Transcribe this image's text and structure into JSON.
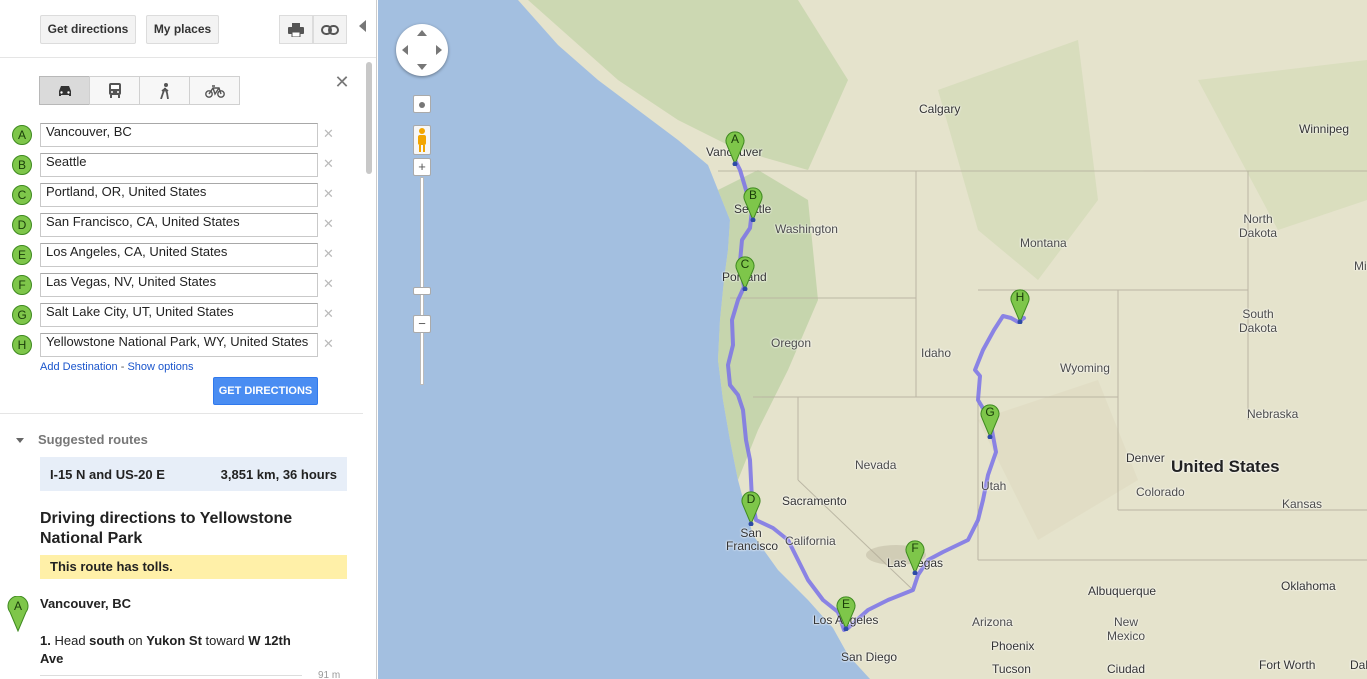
{
  "toolbar": {
    "get_directions": "Get directions",
    "my_places": "My places"
  },
  "waypoints": [
    {
      "letter": "A",
      "value": "Vancouver, BC"
    },
    {
      "letter": "B",
      "value": "Seattle"
    },
    {
      "letter": "C",
      "value": "Portland, OR, United States"
    },
    {
      "letter": "D",
      "value": "San Francisco, CA, United States"
    },
    {
      "letter": "E",
      "value": "Los Angeles, CA, United States"
    },
    {
      "letter": "F",
      "value": "Las Vegas, NV, United States"
    },
    {
      "letter": "G",
      "value": "Salt Lake City, UT, United States"
    },
    {
      "letter": "H",
      "value": "Yellowstone National Park, WY, United States"
    }
  ],
  "links": {
    "add_destination": "Add Destination",
    "separator": "-",
    "show_options": "Show options"
  },
  "get_directions_button": "GET DIRECTIONS",
  "suggested": {
    "heading": "Suggested routes",
    "route_name": "I-15 N and US-20 E",
    "route_detail": "3,851 km, 36 hours"
  },
  "directions": {
    "title": "Driving directions to Yellowstone National Park",
    "tolls_notice": "This route has tolls.",
    "start_letter": "A",
    "start": "Vancouver, BC",
    "step1": {
      "num": "1.",
      "t1": "Head",
      "dir": "south",
      "t2": "on",
      "street": "Yukon St",
      "t3": "toward",
      "street2": "W 12th Ave",
      "dist": "91 m"
    }
  },
  "map": {
    "zoom_plus": "+",
    "zoom_minus": "−",
    "country_label": "United States",
    "city_labels": [
      "Calgary",
      "Winnipeg",
      "Vancouver",
      "Seattle",
      "Portland",
      "Sacramento",
      "San Francisco",
      "Las Vegas",
      "Los Angeles",
      "San Diego",
      "Denver",
      "Phoenix",
      "Tucson",
      "Albuquerque",
      "Ciudad",
      "Oklahoma",
      "Fort Worth",
      "Dal"
    ],
    "state_labels": [
      "Washington",
      "Oregon",
      "Idaho",
      "Montana",
      "North Dakota",
      "South Dakota",
      "Wyoming",
      "Nebraska",
      "Nevada",
      "Utah",
      "Colorado",
      "Kansas",
      "California",
      "Arizona",
      "New Mexico",
      "Mi"
    ],
    "pins": [
      "A",
      "B",
      "C",
      "D",
      "E",
      "F",
      "G",
      "H"
    ]
  },
  "colors": {
    "route": "#7a72e8",
    "ocean": "#a3bfe0",
    "land": "#e8e6d2",
    "marker": "#7ec64a",
    "button_blue": "#4a8df2"
  }
}
